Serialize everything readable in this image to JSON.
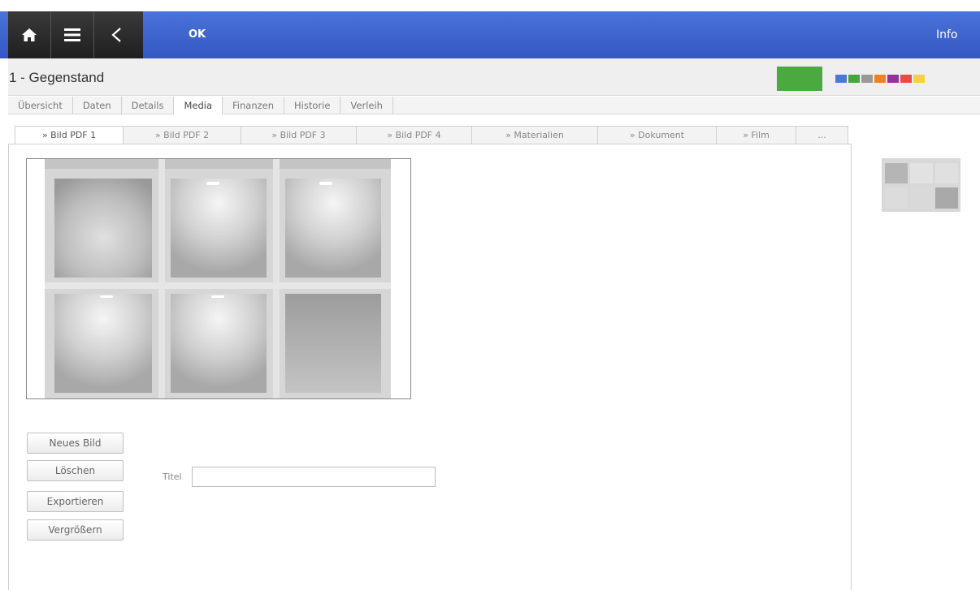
{
  "topbar": {
    "ok_label": "OK",
    "info_label": "Info",
    "icons": [
      "home-icon",
      "menu-icon",
      "back-icon"
    ]
  },
  "header": {
    "title": "1 - Gegenstand",
    "status_color": "#4aa93f",
    "swatches": [
      "#4a79d6",
      "#45a63b",
      "#999999",
      "#f08020",
      "#9b2f9a",
      "#f04848",
      "#f5d23a"
    ]
  },
  "tabs": [
    "Übersicht",
    "Daten",
    "Details",
    "Media",
    "Finanzen",
    "Historie",
    "Verleih"
  ],
  "active_tab": "Media",
  "subtabs": [
    "» Bild PDF 1",
    "» Bild PDF 2",
    "» Bild PDF 3",
    "» Bild PDF 4",
    "» Materialien",
    "» Dokument",
    "» Film",
    "..."
  ],
  "active_subtab": "» Bild PDF 1",
  "buttons": {
    "new_image": "Neues Bild",
    "delete": "Löschen",
    "export": "Exportieren",
    "enlarge": "Vergrößern"
  },
  "title_field": {
    "label": "Titel",
    "value": ""
  }
}
